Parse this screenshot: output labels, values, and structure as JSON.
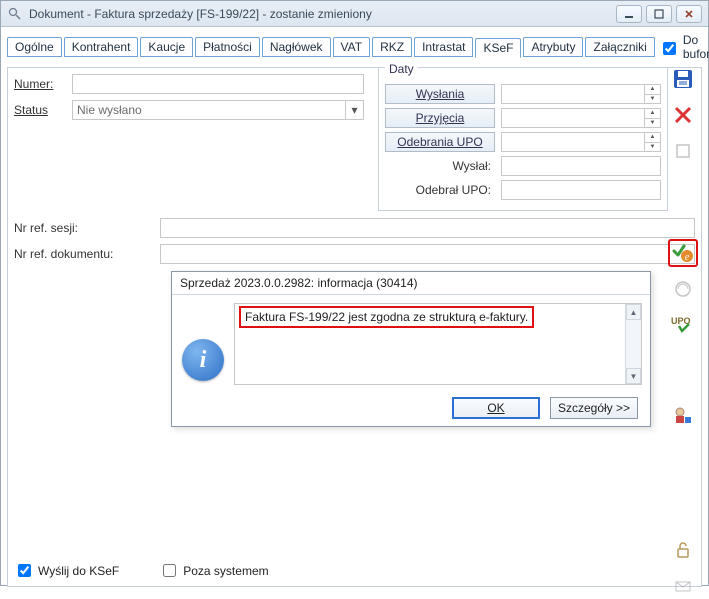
{
  "window": {
    "title": "Dokument - Faktura sprzedaży [FS-199/22]  - zostanie zmieniony"
  },
  "tabs": [
    {
      "label": "Ogólne"
    },
    {
      "label": "Kontrahent"
    },
    {
      "label": "Kaucje"
    },
    {
      "label": "Płatności"
    },
    {
      "label": "Nagłówek"
    },
    {
      "label": "VAT"
    },
    {
      "label": "RKZ"
    },
    {
      "label": "Intrastat"
    },
    {
      "label": "KSeF"
    },
    {
      "label": "Atrybuty"
    },
    {
      "label": "Załączniki"
    }
  ],
  "active_tab_index": 8,
  "dobufora_label": "Do bufora",
  "dobufora_checked": true,
  "left": {
    "numer_label": "Numer:",
    "numer_value": "",
    "status_label": "Status",
    "status_value": "Nie wysłano"
  },
  "daty": {
    "legend": "Daty",
    "rows": [
      {
        "kind": "btn",
        "label": "Wysłania",
        "value": ""
      },
      {
        "kind": "btn",
        "label": "Przyjęcia",
        "value": ""
      },
      {
        "kind": "btn",
        "label": "Odebrania UPO",
        "value": ""
      },
      {
        "kind": "lbl",
        "label": "Wysłał:",
        "value": ""
      },
      {
        "kind": "lbl",
        "label": "Odebrał UPO:",
        "value": ""
      }
    ]
  },
  "refs": {
    "sesji_label": "Nr ref. sesji:",
    "sesji_value": "",
    "doku_label": "Nr ref. dokumentu:",
    "doku_value": ""
  },
  "bottom": {
    "wyslij_label": "Wyślij do KSeF",
    "wyslij_checked": true,
    "poza_label": "Poza systemem",
    "poza_checked": false
  },
  "dialog": {
    "title": "Sprzedaż 2023.0.0.2982: informacja (30414)",
    "message": "Faktura FS-199/22 jest zgodna ze strukturą e-faktury.",
    "ok_label": "OK",
    "details_label": "Szczegóły >>"
  }
}
